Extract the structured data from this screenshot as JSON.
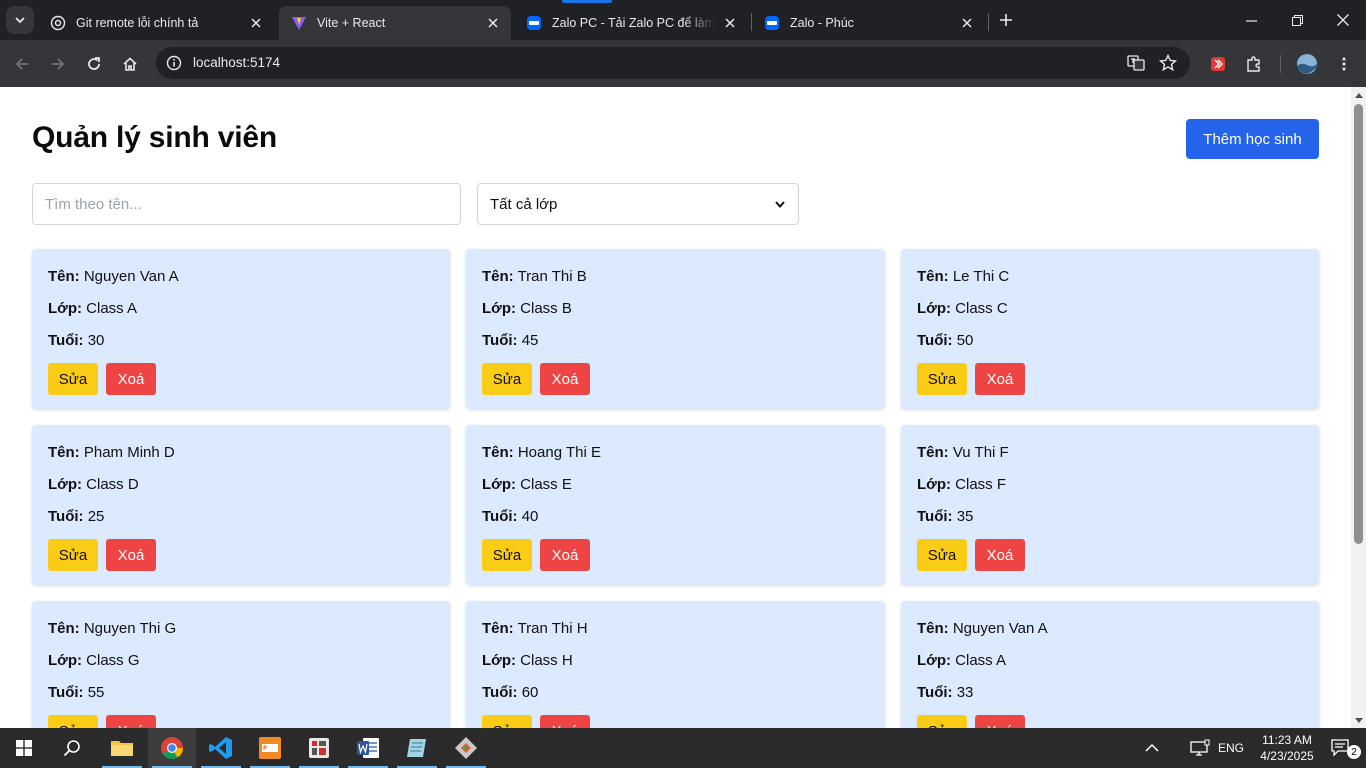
{
  "browser": {
    "tabs": [
      {
        "title": "Git remote lỗi chính tả",
        "icon": "openai-icon",
        "active": false
      },
      {
        "title": "Vite + React",
        "icon": "vite-icon",
        "active": true
      },
      {
        "title": "Zalo PC - Tải Zalo PC để làm việc",
        "icon": "zalo-icon",
        "active": false
      },
      {
        "title": "Zalo - Phúc",
        "icon": "zalo-icon",
        "active": false
      }
    ],
    "url": "localhost:5174"
  },
  "page": {
    "title": "Quản lý sinh viên",
    "add_button": "Thêm học sinh",
    "search_placeholder": "Tìm theo tên...",
    "class_filter": "Tất cả lớp",
    "labels": {
      "name": "Tên:",
      "class": "Lớp:",
      "age": "Tuổi:"
    },
    "edit_label": "Sửa",
    "delete_label": "Xoá",
    "students": [
      {
        "name": "Nguyen Van A",
        "class": "Class A",
        "age": "30"
      },
      {
        "name": "Tran Thi B",
        "class": "Class B",
        "age": "45"
      },
      {
        "name": "Le Thi C",
        "class": "Class C",
        "age": "50"
      },
      {
        "name": "Pham Minh D",
        "class": "Class D",
        "age": "25"
      },
      {
        "name": "Hoang Thi E",
        "class": "Class E",
        "age": "40"
      },
      {
        "name": "Vu Thi F",
        "class": "Class F",
        "age": "35"
      },
      {
        "name": "Nguyen Thi G",
        "class": "Class G",
        "age": "55"
      },
      {
        "name": "Tran Thi H",
        "class": "Class H",
        "age": "60"
      },
      {
        "name": "Nguyen Van A",
        "class": "Class A",
        "age": "33"
      }
    ]
  },
  "taskbar": {
    "language": "ENG",
    "time": "11:23 AM",
    "date": "4/23/2025",
    "notifications": "2"
  },
  "colors": {
    "primary": "#2563eb",
    "card_bg": "#dbeafe",
    "edit": "#facc15",
    "delete": "#ef4444"
  }
}
